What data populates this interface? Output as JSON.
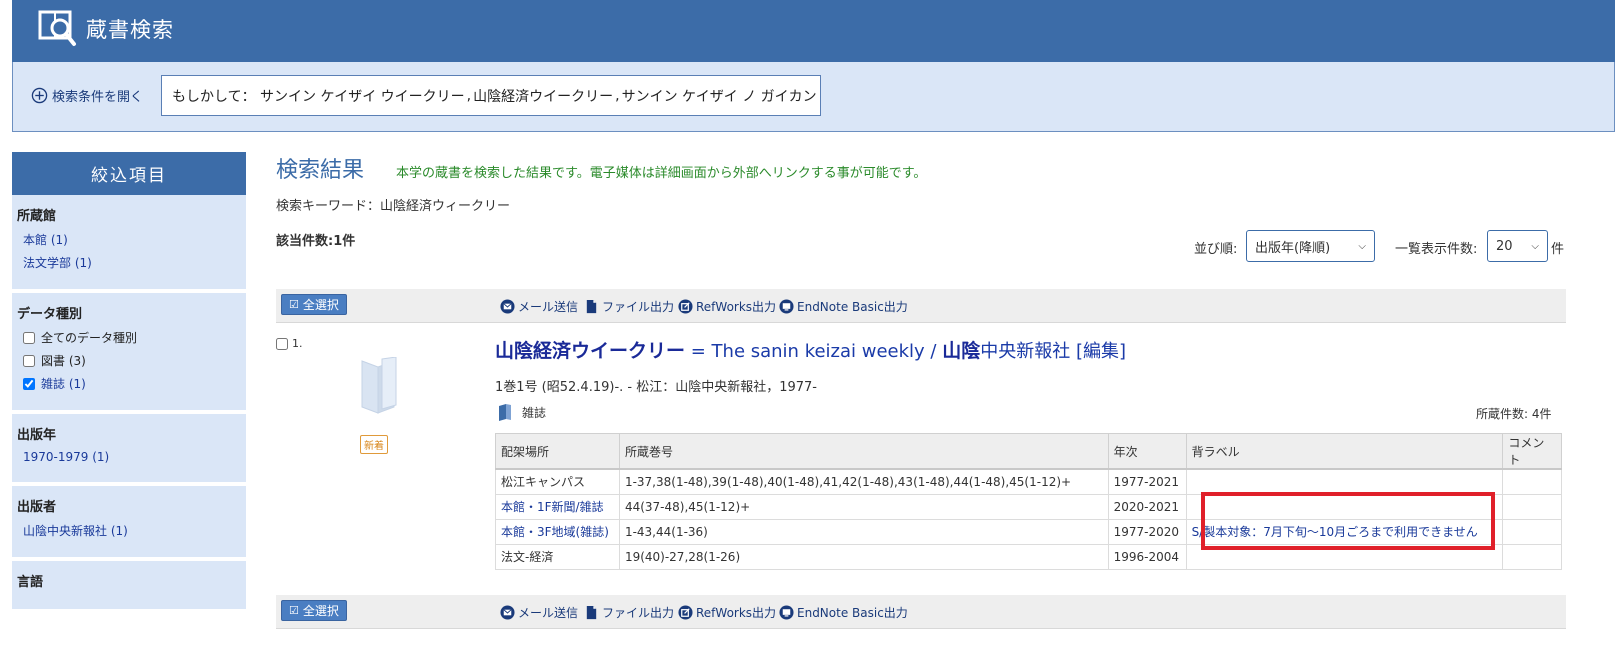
{
  "header": {
    "title": "蔵書検索",
    "logo_icon": "book-search-icon"
  },
  "search_bar": {
    "open_conditions": "検索条件を開く",
    "did_you_mean_label": "もしかして：",
    "suggestions": [
      "サンイン ケイザイ ウイークリー",
      "山陰経済ウイークリー",
      "サンイン ケイザイ ノ ガイカン"
    ],
    "separator": ","
  },
  "sidebar": {
    "title": "絞込項目",
    "facets": {
      "library": {
        "title": "所蔵館",
        "items": [
          "本館 (1)",
          "法文学部 (1)"
        ]
      },
      "data_type": {
        "title": "データ種別",
        "items": [
          {
            "label": "全てのデータ種別",
            "checked": false
          },
          {
            "label": "図書 (3)",
            "checked": false
          },
          {
            "label": "雑誌 (1)",
            "checked": true
          }
        ]
      },
      "year": {
        "title": "出版年",
        "items": [
          "1970-1979 (1)"
        ]
      },
      "publisher": {
        "title": "出版者",
        "items": [
          "山陰中央新報社 (1)"
        ]
      },
      "language": {
        "title": "言語"
      }
    }
  },
  "results": {
    "title": "検索結果",
    "description": "本学の蔵書を検索した結果です。電子媒体は詳細画面から外部へリンクする事が可能です。",
    "keyword": "検索キーワード：山陰経済ウィークリー",
    "count": "該当件数:1件",
    "sort_label": "並び順:",
    "sort_value": "出版年(降順)",
    "per_page_label": "一覧表示件数:",
    "per_page_value": "20",
    "per_page_unit": "件"
  },
  "toolbar": {
    "select_all": "全選択",
    "mail": "メール送信",
    "file": "ファイル出力",
    "refworks": "RefWorks出力",
    "endnote": "EndNote Basic出力"
  },
  "record": {
    "number": "1.",
    "badge": "新着",
    "title_main": "山陰経済ウイークリー",
    "title_rest": " = The sanin keizai weekly / ",
    "author_hl": "山陰",
    "author_rest": "中央新報社",
    "edit": " [編集]",
    "pub": "1巻1号 (昭52.4.19)-. - 松江：山陰中央新報社，1977-",
    "type": "雑誌",
    "holdings_count": "所蔵件数: 4件",
    "holdings_headers": [
      "配架場所",
      "所蔵巻号",
      "年次",
      "背ラベル",
      "コメント"
    ],
    "holdings": [
      {
        "location": "松江キャンパス",
        "volumes": "1-37,38(1-48),39(1-48),40(1-48),41,42(1-48),43(1-48),44(1-48),45(1-12)+",
        "years": "1977-2021",
        "label": "",
        "comment": ""
      },
      {
        "location": "本館・1F新聞/雑誌",
        "volumes": "44(37-48),45(1-12)+",
        "years": "2020-2021",
        "label": "",
        "comment": ""
      },
      {
        "location": "本館・3F地域(雑誌)",
        "volumes": "1-43,44(1-36)",
        "years": "1977-2020",
        "label": "S/製本対象：7月下旬～10月ごろまで利用できません",
        "comment": ""
      },
      {
        "location": "法文-経済",
        "volumes": "19(40)-27,28(1-26)",
        "years": "1996-2004",
        "label": "",
        "comment": ""
      }
    ]
  },
  "colors": {
    "brand": "#3c6ca8",
    "panel": "#dae6f7",
    "link": "#1a3a9a",
    "highlight_box": "#e0202a",
    "desc_green": "#2a8a2a"
  }
}
